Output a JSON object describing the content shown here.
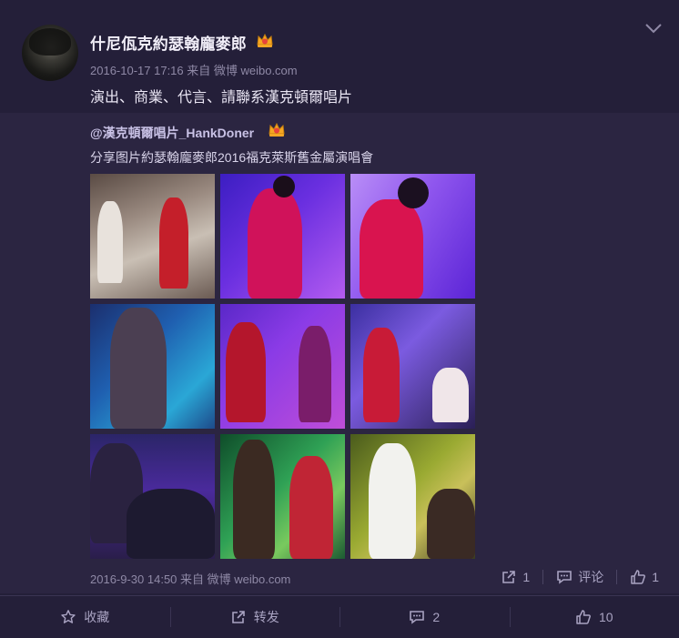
{
  "post": {
    "username": "什尼佤克約瑟翰龐麥郎",
    "meta": "2016-10-17 17:16 来自 微博 weibo.com",
    "text": "演出、商業、代言、請聯系漢克頓爾唱片"
  },
  "repost": {
    "author": "@漢克頓爾唱片_HankDoner",
    "text": "分享图片約瑟翰龐麥郎2016福克萊斯舊金屬演唱會",
    "photo_count": 9,
    "meta": "2016-9-30 14:50 来自 微博 weibo.com",
    "actions": {
      "forward_count": "1",
      "comment_label": "评论",
      "like_count": "1"
    }
  },
  "bottom_bar": {
    "favorite_label": "收藏",
    "forward_label": "转发",
    "comment_count": "2",
    "like_count": "10"
  },
  "icons": {
    "crown": "crown-badge-icon",
    "menu": "chevron-down-icon",
    "forward": "share-icon",
    "comment": "comment-icon",
    "like": "thumbs-up-icon",
    "favorite": "star-icon"
  },
  "colors": {
    "background": "#241f39",
    "repost_background": "#2b2541",
    "text": "#eae6f4",
    "muted": "#8f89a6",
    "badge": "#f5a623"
  }
}
